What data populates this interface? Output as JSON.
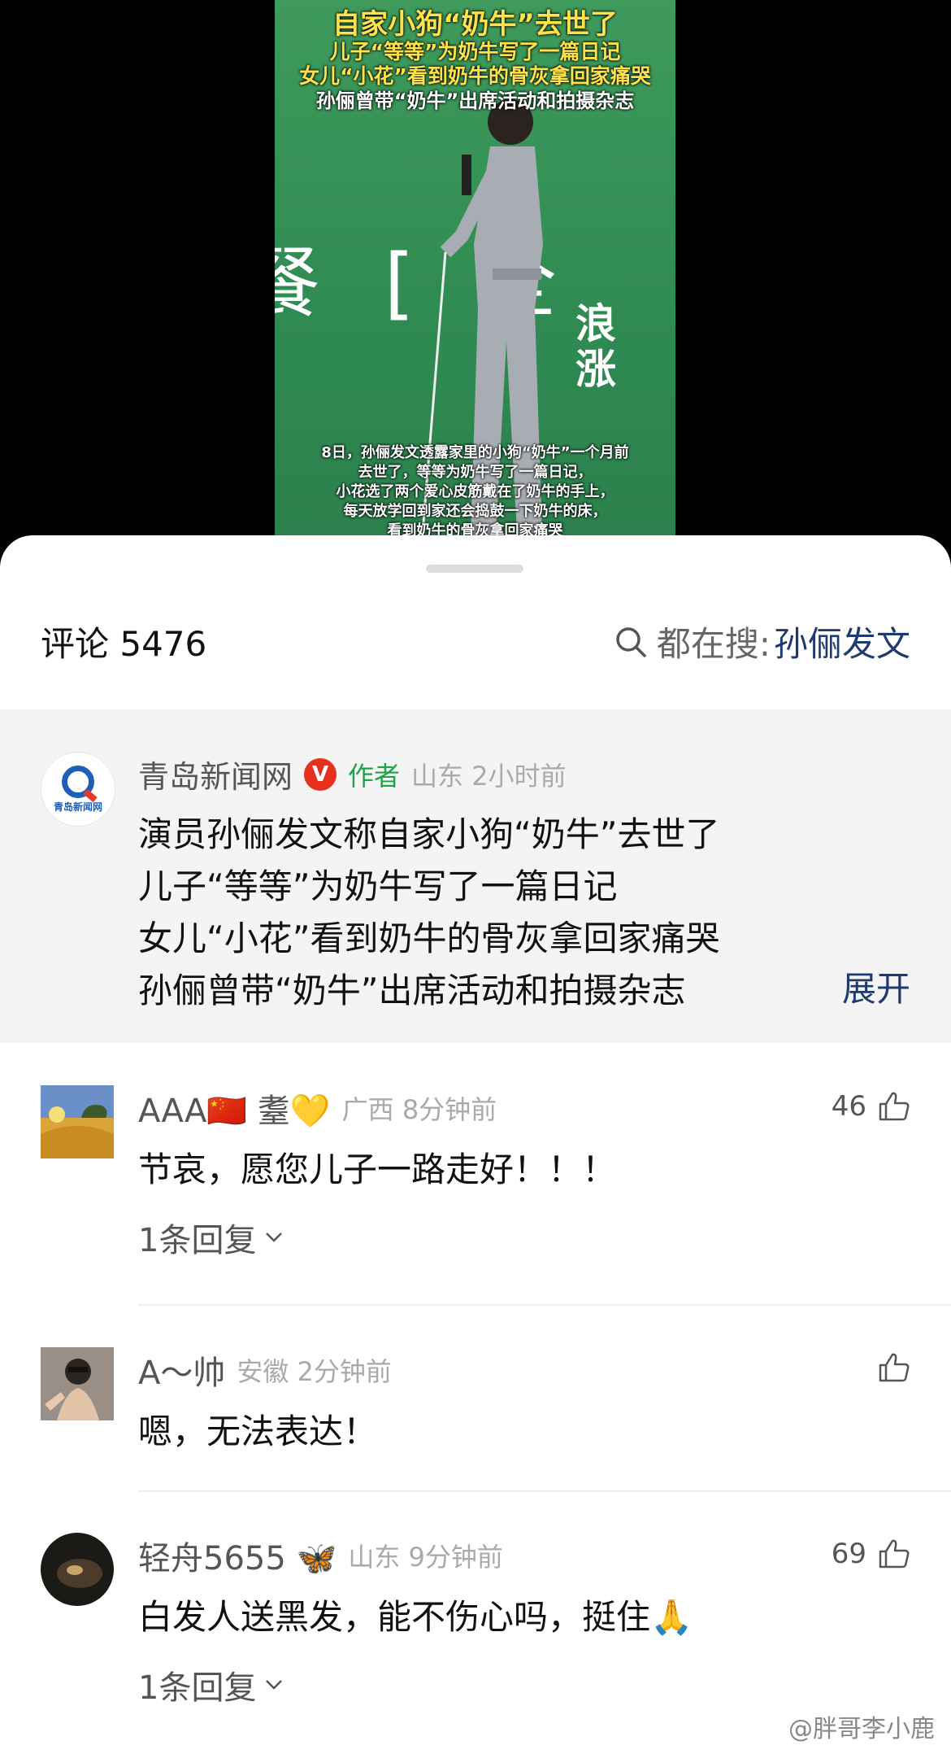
{
  "video": {
    "caption_lines": [
      "自家小狗“奶牛”去世了",
      "儿子“等等”为奶牛写了一篇日记",
      "女儿“小花”看到奶牛的骨灰拿回家痛哭",
      "孙俪曾带“奶牛”出席活动和拍摄杂志"
    ],
    "background_glyphs": "餐 [ 全",
    "logo_text": "浪涨",
    "subtitle_lines": [
      "8日，孙俪发文透露家里的小狗“奶牛”一个月前",
      "去世了，等等为奶牛写了一篇日记，",
      "小花选了两个爱心皮筋戴在了奶牛的手上，",
      "每天放学回到家还会捣鼓一下奶牛的床，",
      "看到奶牛的骨灰拿回家痛哭"
    ]
  },
  "header": {
    "title": "评论 5476",
    "search_prefix": "都在搜:",
    "search_topic": "孙俪发文",
    "search_icon": "search-icon"
  },
  "author_post": {
    "name": "青岛新闻网",
    "verified_badge": "V",
    "tag": "作者",
    "location_time": "山东 2小时前",
    "avatar_text": "青岛新闻网",
    "lines": [
      "演员孙俪发文称自家小狗“奶牛”去世了",
      "儿子“等等”为奶牛写了一篇日记",
      "女儿“小花”看到奶牛的骨灰拿回家痛哭",
      "孙俪曾带“奶牛”出席活动和拍摄杂志"
    ],
    "expand_label": "展开"
  },
  "comments": [
    {
      "name": "AAA🇨🇳 耋💛",
      "meta": "广西 8分钟前",
      "likes": "46",
      "text": "节哀，愿您儿子一路走好！！！",
      "replies": "1条回复"
    },
    {
      "name": "A～帅",
      "meta": "安徽 2分钟前",
      "likes": "",
      "text": "嗯，无法表达！",
      "replies": ""
    },
    {
      "name": "轻舟5655 🦋",
      "meta": "山东 9分钟前",
      "likes": "69",
      "text": "白发人送黑发，能不伤心吗，挺住🙏",
      "replies": "1条回复"
    }
  ],
  "footer": {
    "watermark": "@胖哥李小鹿"
  },
  "colors": {
    "link_blue": "#1e3a6e",
    "author_tag_green": "#1fa34a",
    "verified_red": "#e8301f",
    "caption_yellow": "#ffe14a"
  }
}
